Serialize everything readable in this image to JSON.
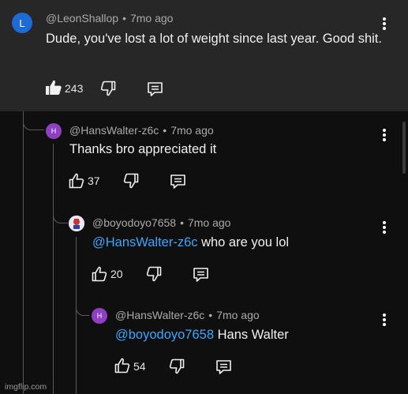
{
  "comments": [
    {
      "avatar_letter": "L",
      "handle": "@LeonShallop",
      "dot": "•",
      "time": "7mo ago",
      "text": "Dude, you've lost a lot of weight since last year. Good shit.",
      "likes": "243",
      "liked": true
    },
    {
      "avatar_letter": "H",
      "handle": "@HansWalter-z6c",
      "dot": "•",
      "time": "7mo ago",
      "text": "Thanks bro appreciated it",
      "likes": "37"
    },
    {
      "handle": "@boyodoyo7658",
      "dot": "•",
      "time": "7mo ago",
      "mention": "@HansWalter-z6c",
      "text": " who are you lol",
      "likes": "20"
    },
    {
      "avatar_letter": "H",
      "handle": "@HansWalter-z6c",
      "dot": "•",
      "time": "7mo ago",
      "mention": "@boyodoyo7658",
      "text": " Hans Walter",
      "likes": "54"
    }
  ],
  "watermark": "imgflip.com",
  "colors": {
    "background": "#0f0f0f",
    "highlight_band": "#272727",
    "mention": "#3ea6ff",
    "avatar_l": "#1e6bd6",
    "avatar_h": "#8e3fc2"
  },
  "icons": {
    "like": "thumbs-up-icon",
    "dislike": "thumbs-down-icon",
    "reply": "reply-comment-icon",
    "menu": "more-vertical-icon"
  }
}
